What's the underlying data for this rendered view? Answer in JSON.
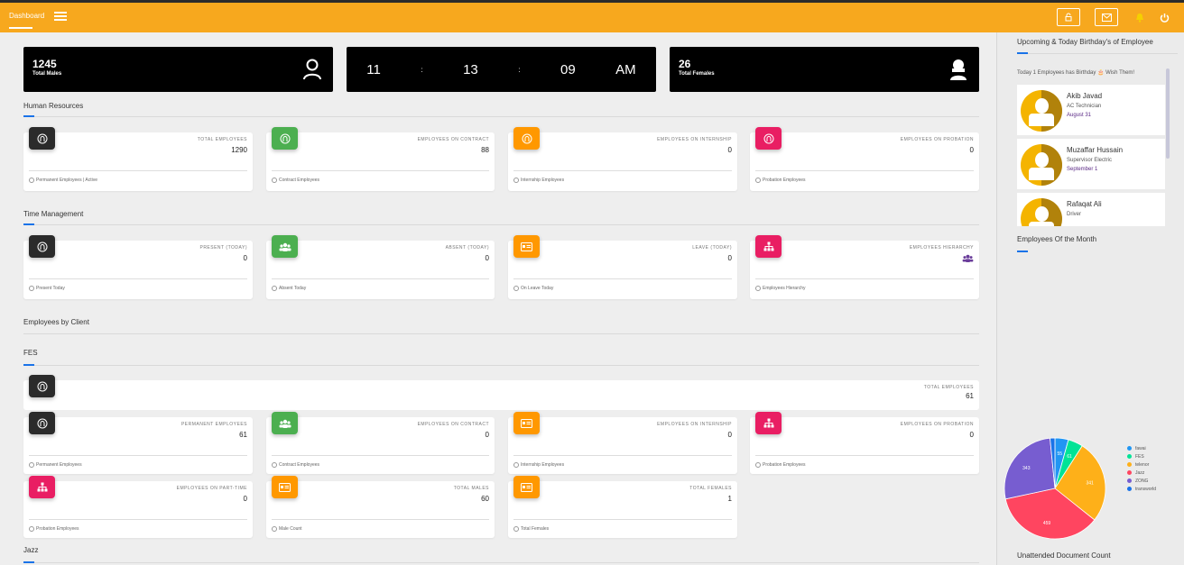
{
  "topbar": {
    "title": "Dashboard",
    "icons": [
      "lock-icon",
      "mail-icon",
      "bell-icon",
      "power-icon"
    ],
    "color": "#f7a81e"
  },
  "stats": {
    "males": {
      "value": "1245",
      "label": "Total Males"
    },
    "clock": {
      "hours": "11",
      "minutes": "13",
      "seconds": "09",
      "ampm": "AM",
      "sep": ":"
    },
    "females": {
      "value": "26",
      "label": "Total Females"
    }
  },
  "sections": {
    "hr": "Human Resources",
    "tm": "Time Management",
    "client": "Employees by Client",
    "fes": "FES",
    "jazz": "Jazz"
  },
  "hr_cards": [
    {
      "caption": "TOTAL EMPLOYEES",
      "value": "1290",
      "footer": "Permanent Employees | Active",
      "color": "#2b2b2b",
      "icon": "fingerprint-icon"
    },
    {
      "caption": "EMPLOYEES ON CONTRACT",
      "value": "88",
      "footer": "Contract Employees",
      "color": "#4caf50",
      "icon": "fingerprint-icon"
    },
    {
      "caption": "EMPLOYEES ON INTERNSHIP",
      "value": "0",
      "footer": "Internship Employees",
      "color": "#ff9800",
      "icon": "fingerprint-icon"
    },
    {
      "caption": "EMPLOYEES ON PROBATION",
      "value": "0",
      "footer": "Probation Employees",
      "color": "#e91e63",
      "icon": "fingerprint-icon"
    }
  ],
  "tm_cards": [
    {
      "caption": "PRESENT (TODAY)",
      "value": "0",
      "footer": "Present Today",
      "color": "#2b2b2b",
      "icon": "fingerprint-icon"
    },
    {
      "caption": "ABSENT (TODAY)",
      "value": "0",
      "footer": "Absent Today",
      "color": "#4caf50",
      "icon": "users-icon"
    },
    {
      "caption": "LEAVE (TODAY)",
      "value": "0",
      "footer": "On Leave Today",
      "color": "#ff9800",
      "icon": "id-card-icon"
    },
    {
      "caption": "EMPLOYEES HIERARCHY",
      "value": "",
      "footer": "Employees Hierarchy",
      "color": "#e91e63",
      "icon": "sitemap-icon"
    }
  ],
  "fes_total": {
    "caption": "TOTAL EMPLOYEES",
    "value": "61"
  },
  "fes_cards": [
    {
      "caption": "PERMANENT EMPLOYEES",
      "value": "61",
      "footer": "Permanent Employees",
      "color": "#2b2b2b",
      "icon": "fingerprint-icon"
    },
    {
      "caption": "EMPLOYEES ON CONTRACT",
      "value": "0",
      "footer": "Contract Employees",
      "color": "#4caf50",
      "icon": "users-icon"
    },
    {
      "caption": "EMPLOYEES ON INTERNSHIP",
      "value": "0",
      "footer": "Internship Employees",
      "color": "#ff9800",
      "icon": "id-card-icon"
    },
    {
      "caption": "EMPLOYEES ON PROBATION",
      "value": "0",
      "footer": "Probation Employees",
      "color": "#e91e63",
      "icon": "sitemap-icon"
    },
    {
      "caption": "EMPLOYEES ON PART-TIME",
      "value": "0",
      "footer": "Probation Employees",
      "color": "#e91e63",
      "icon": "sitemap-icon"
    },
    {
      "caption": "TOTAL MALES",
      "value": "60",
      "footer": "Male Count",
      "color": "#ff9800",
      "icon": "id-card-icon"
    },
    {
      "caption": "TOTAL FEMALES",
      "value": "1",
      "footer": "Total Females",
      "color": "#ff9800",
      "icon": "id-card-icon"
    }
  ],
  "sidebar": {
    "birthday_title": "Upcoming & Today Birthday's of Employee",
    "birthday_note": "Today 1 Employees has Birthday 🎂 Wish Them!",
    "birthdays": [
      {
        "name": "Akib Javad",
        "role": "AC Technician",
        "date": "August 31"
      },
      {
        "name": "Muzaffar Hussain",
        "role": "Supervisor Electric",
        "date": "September 1"
      },
      {
        "name": "Rafaqat Ali",
        "role": "Driver",
        "date": ""
      }
    ],
    "month_title": "Employees Of the Month",
    "doc_title": "Unattended Document Count"
  },
  "chart_data": {
    "type": "pie",
    "title": "",
    "labels": [
      "fawai",
      "FES",
      "telenor",
      "Jazz",
      "ZONG",
      "transworld"
    ],
    "values": [
      55,
      61,
      341,
      459,
      343,
      20
    ],
    "colors": [
      "#2196f3",
      "#00e396",
      "#feb019",
      "#ff4560",
      "#775dd0",
      "#1a73e8"
    ]
  }
}
